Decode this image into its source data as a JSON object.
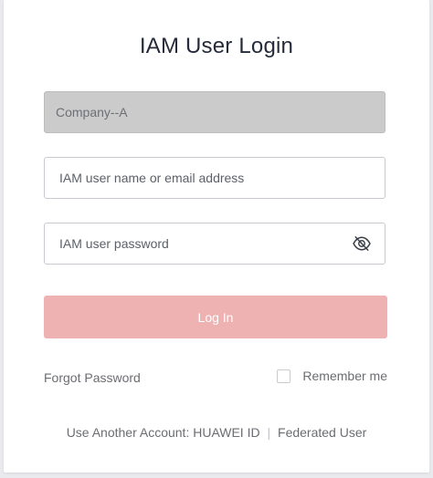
{
  "title": "IAM User Login",
  "company": {
    "value": "Company--A"
  },
  "username": {
    "placeholder": "IAM user name or email address"
  },
  "password": {
    "placeholder": "IAM user password",
    "toggle_icon": "eye-off-icon"
  },
  "login_button": {
    "label": "Log In",
    "color": "#efb2b3"
  },
  "forgot_password": "Forgot Password",
  "remember_me": {
    "label": "Remember me",
    "checked": false
  },
  "other_account": {
    "prefix": "Use Another Account:",
    "huawei_id": "HUAWEI ID",
    "separator": "|",
    "federated": "Federated User"
  }
}
